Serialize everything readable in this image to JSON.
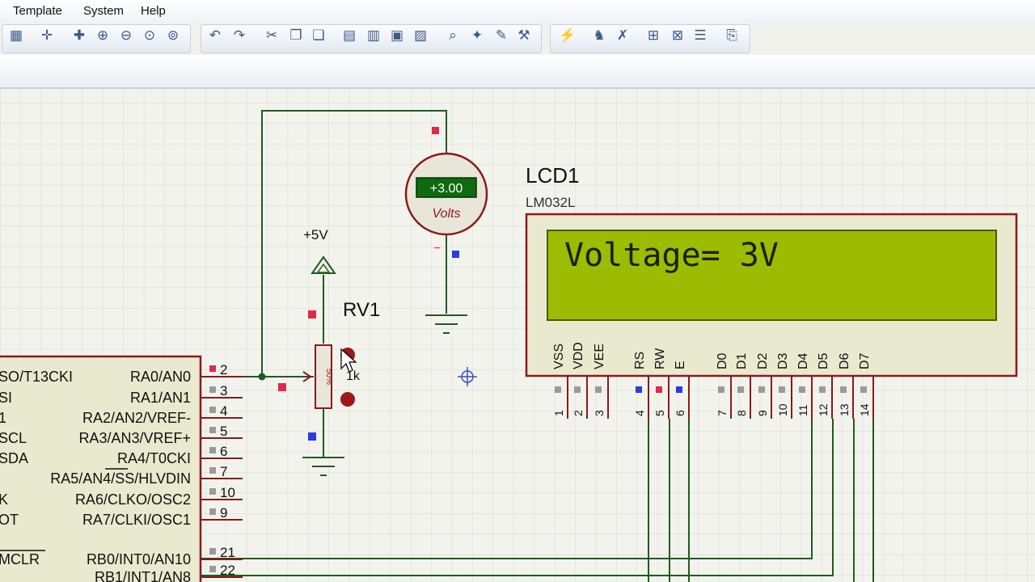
{
  "menu": {
    "items": [
      "Template",
      "System",
      "Help"
    ]
  },
  "toolbar": {
    "buttons": [
      "grid-icon",
      "origin-icon",
      "pan-icon",
      "zoom-in-icon",
      "zoom-out-icon",
      "zoom-all-icon",
      "zoom-area-icon",
      "undo-icon",
      "redo-icon",
      "cut-icon",
      "copy-icon",
      "paste-icon",
      "block-copy-icon",
      "block-move-icon",
      "block-rotate-icon",
      "block-delete-icon",
      "pick-device-icon",
      "make-device-icon",
      "packaging-icon",
      "decompose-icon",
      "wire-autorouter-icon",
      "search-tag-icon",
      "property-tool-icon",
      "new-sheet-icon",
      "remove-sheet-icon",
      "bom-icon",
      "electrical-check-icon"
    ]
  },
  "voltmeter": {
    "reading": "+3.00",
    "unit": "Volts",
    "plus": "+",
    "minus": "−"
  },
  "power": {
    "label": "+5V"
  },
  "pot": {
    "name": "RV1",
    "value": "1k",
    "percent": "50%"
  },
  "lcd": {
    "name": "LCD1",
    "model": "LM032L",
    "display": "Voltage= 3V",
    "pins": [
      {
        "name": "VSS",
        "num": "1"
      },
      {
        "name": "VDD",
        "num": "2"
      },
      {
        "name": "VEE",
        "num": "3"
      },
      {
        "name": "RS",
        "num": "4"
      },
      {
        "name": "RW",
        "num": "5"
      },
      {
        "name": "E",
        "num": "6"
      },
      {
        "name": "D0",
        "num": "7"
      },
      {
        "name": "D1",
        "num": "8"
      },
      {
        "name": "D2",
        "num": "9"
      },
      {
        "name": "D3",
        "num": "10"
      },
      {
        "name": "D4",
        "num": "11"
      },
      {
        "name": "D5",
        "num": "12"
      },
      {
        "name": "D6",
        "num": "13"
      },
      {
        "name": "D7",
        "num": "14"
      }
    ]
  },
  "mcu": {
    "left_labels": [
      "SO/T13CKI",
      "SI",
      "1",
      "SCL",
      "SDA",
      "K",
      "OT",
      "MCLR"
    ],
    "pins": [
      {
        "label": "RA0/AN0",
        "num": "2"
      },
      {
        "label": "RA1/AN1",
        "num": "3"
      },
      {
        "label": "RA2/AN2/VREF-",
        "num": "4"
      },
      {
        "label": "RA3/AN3/VREF+",
        "num": "5"
      },
      {
        "label": "RA4/T0CKI",
        "num": "6"
      },
      {
        "label": "RA5/AN4/SS/HLVDIN",
        "num": "7"
      },
      {
        "label": "RA6/CLKO/OSC2",
        "num": "10"
      },
      {
        "label": "RA7/CLKI/OSC1",
        "num": "9"
      },
      {
        "label": "RB0/INT0/AN10",
        "num": "21"
      },
      {
        "label": "RB1/INT1/AN8",
        "num": "22"
      }
    ]
  },
  "colors": {
    "wire": "#1f5b1f",
    "component": "#8b1a1a",
    "lcd_screen": "#9dbb00",
    "lcd_body": "#e9e9cf",
    "pin_red": "#e0294a",
    "pin_blue": "#2a3be0",
    "meter_display": "#0f6a10",
    "grid": "#d7d7cf"
  }
}
